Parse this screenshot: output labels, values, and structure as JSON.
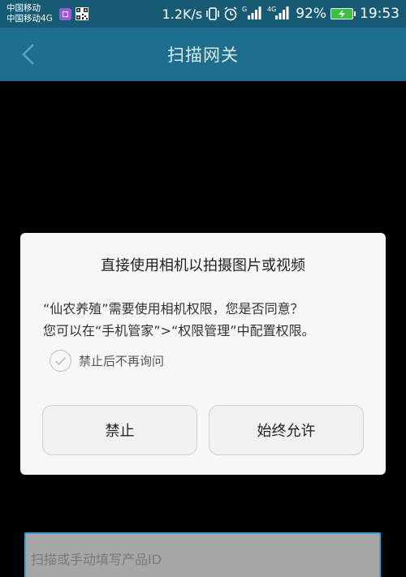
{
  "status_bar": {
    "carrier_1": "中国移动",
    "carrier_2": "中国移动4G",
    "net_speed": "1.2K/s",
    "signal_label": "G",
    "network_label": "4G",
    "battery_percent": "92%",
    "time": "19:53"
  },
  "app_bar": {
    "title": "扫描网关",
    "back_icon": "chevron-left-icon"
  },
  "dialog": {
    "title": "直接使用相机以拍摄图片或视频",
    "message_line1": "“仙农养殖”需要使用相机权限，您是否同意？",
    "message_line2": "您可以在“手机管家”>“权限管理”中配置权限。",
    "remember_label": "禁止后不再询问",
    "deny_label": "禁止",
    "allow_label": "始终允许"
  },
  "product_input": {
    "placeholder": "扫描或手动填写产品ID"
  },
  "colors": {
    "app_bar": "#1d6e8e",
    "status_bar": "#175a74",
    "dialog_bg": "#f7f7f7",
    "input_border": "#3aa2d0"
  }
}
